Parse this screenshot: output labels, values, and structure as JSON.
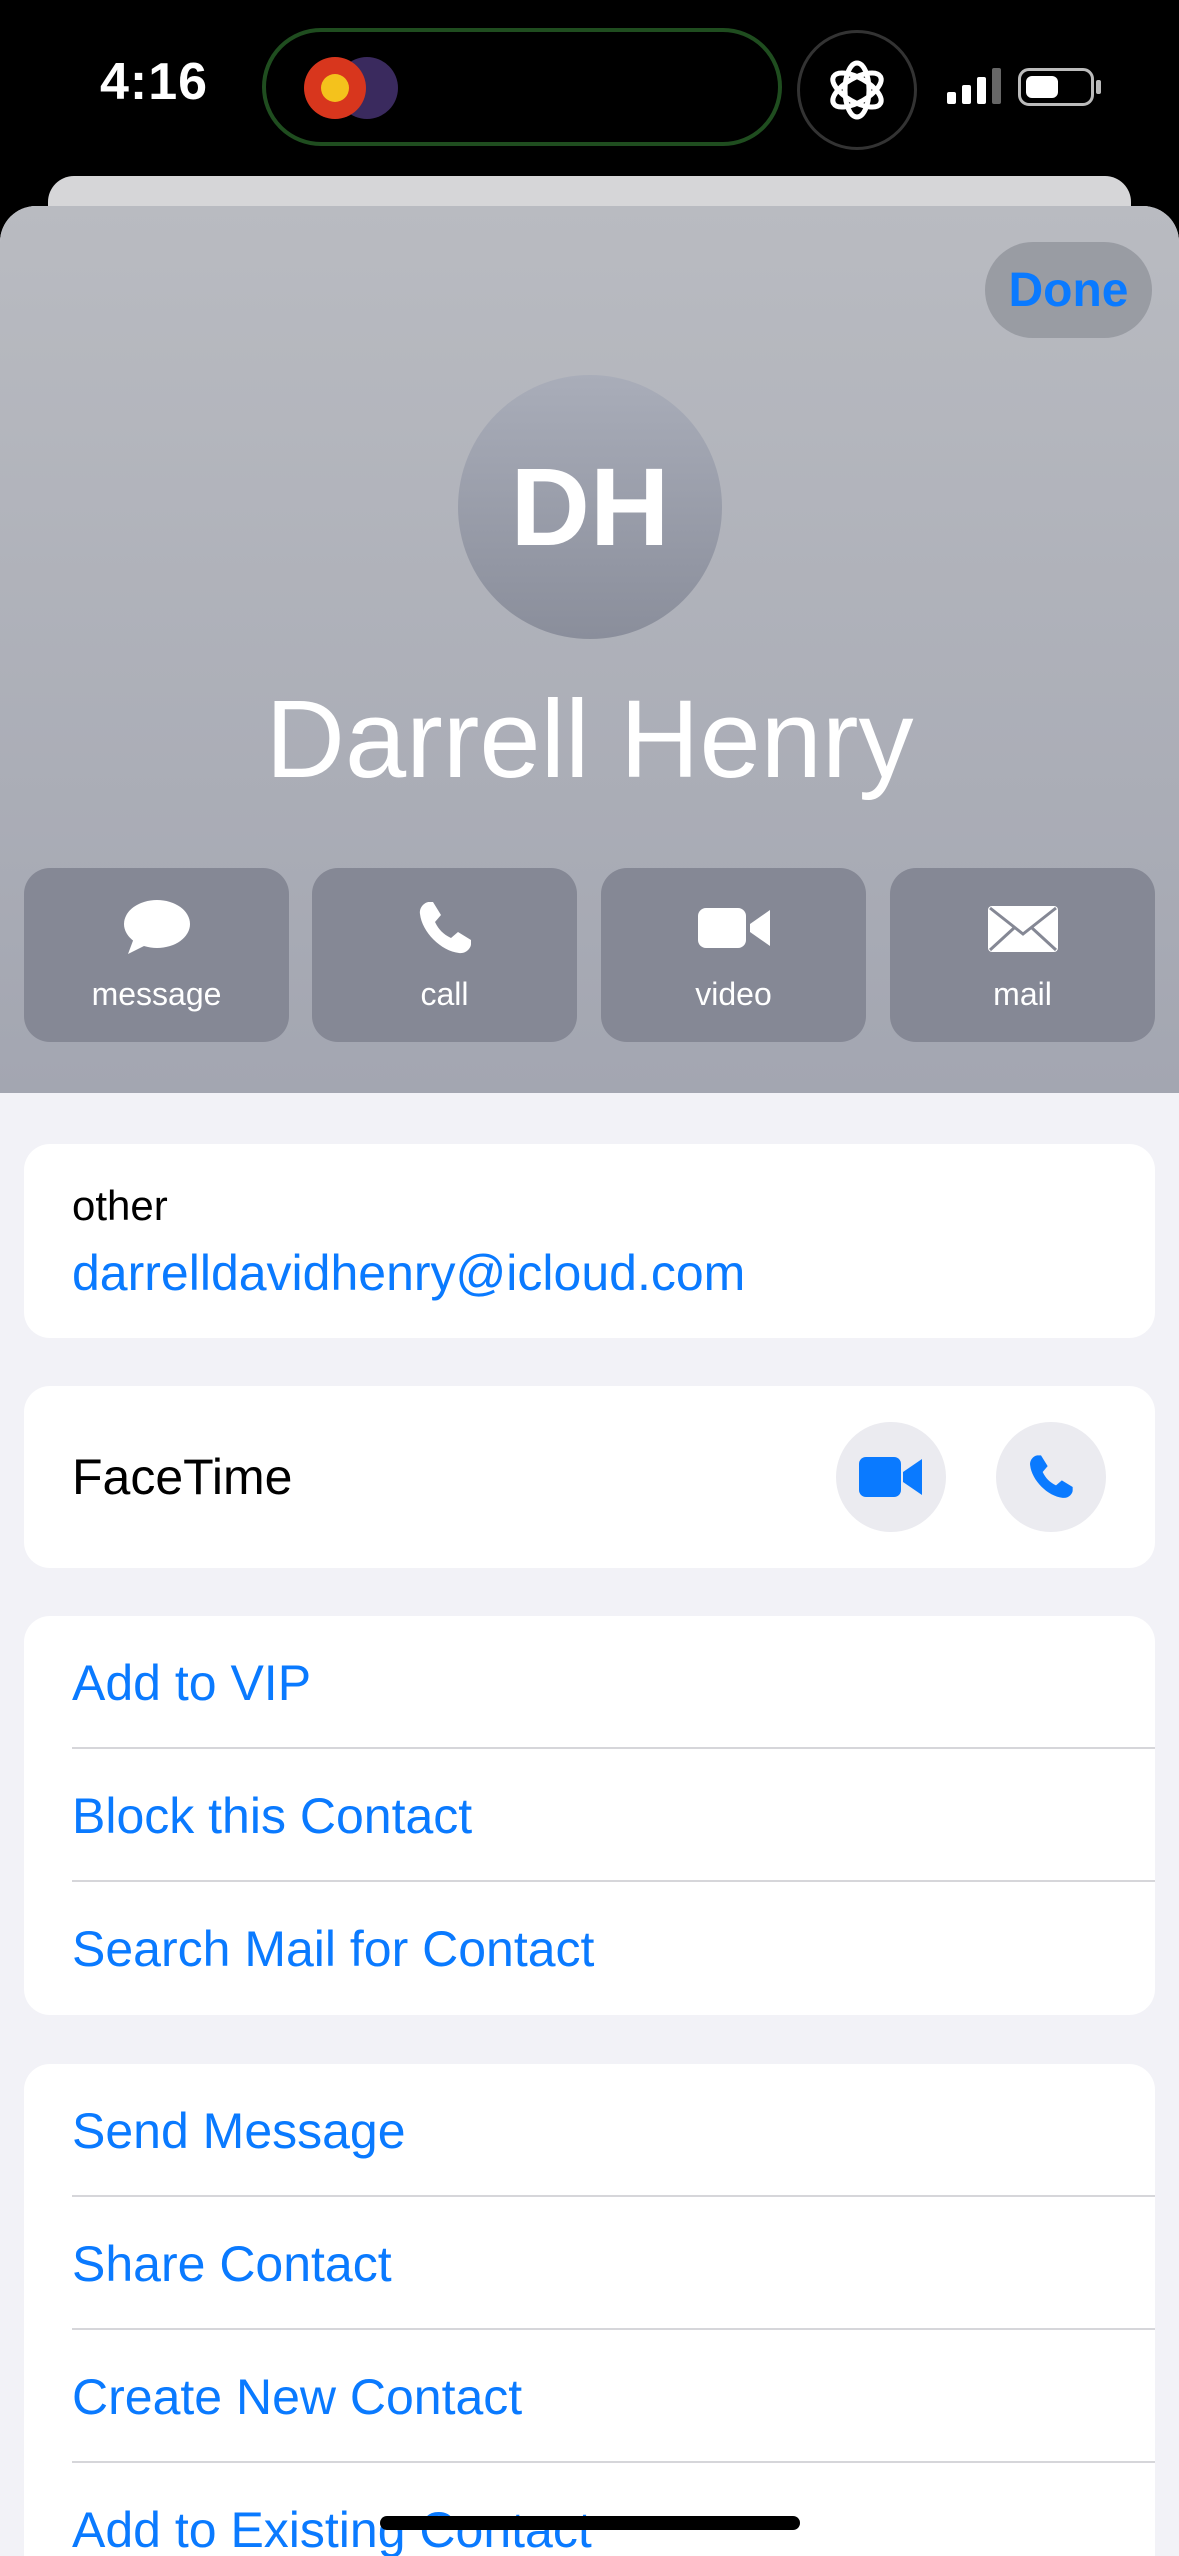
{
  "status_bar": {
    "time": "4:16"
  },
  "header": {
    "done_label": "Done",
    "initials": "DH",
    "name": "Darrell Henry"
  },
  "actions": [
    {
      "label": "message",
      "icon": "message-bubble-icon"
    },
    {
      "label": "call",
      "icon": "phone-icon"
    },
    {
      "label": "video",
      "icon": "video-camera-icon"
    },
    {
      "label": "mail",
      "icon": "envelope-icon"
    }
  ],
  "email_card": {
    "label": "other",
    "value": "darrelldavidhenry@icloud.com"
  },
  "facetime_card": {
    "label": "FaceTime"
  },
  "options_group_1": [
    {
      "label": "Add to VIP"
    },
    {
      "label": "Block this Contact"
    },
    {
      "label": "Search Mail for Contact"
    }
  ],
  "options_group_2": [
    {
      "label": "Send Message"
    },
    {
      "label": "Share Contact"
    },
    {
      "label": "Create New Contact"
    },
    {
      "label": "Add to Existing Contact"
    }
  ],
  "colors": {
    "accent": "#0a7aff",
    "header_bg": "#a3a6b1",
    "action_bg": "#858895",
    "page_bg": "#f2f2f7"
  }
}
